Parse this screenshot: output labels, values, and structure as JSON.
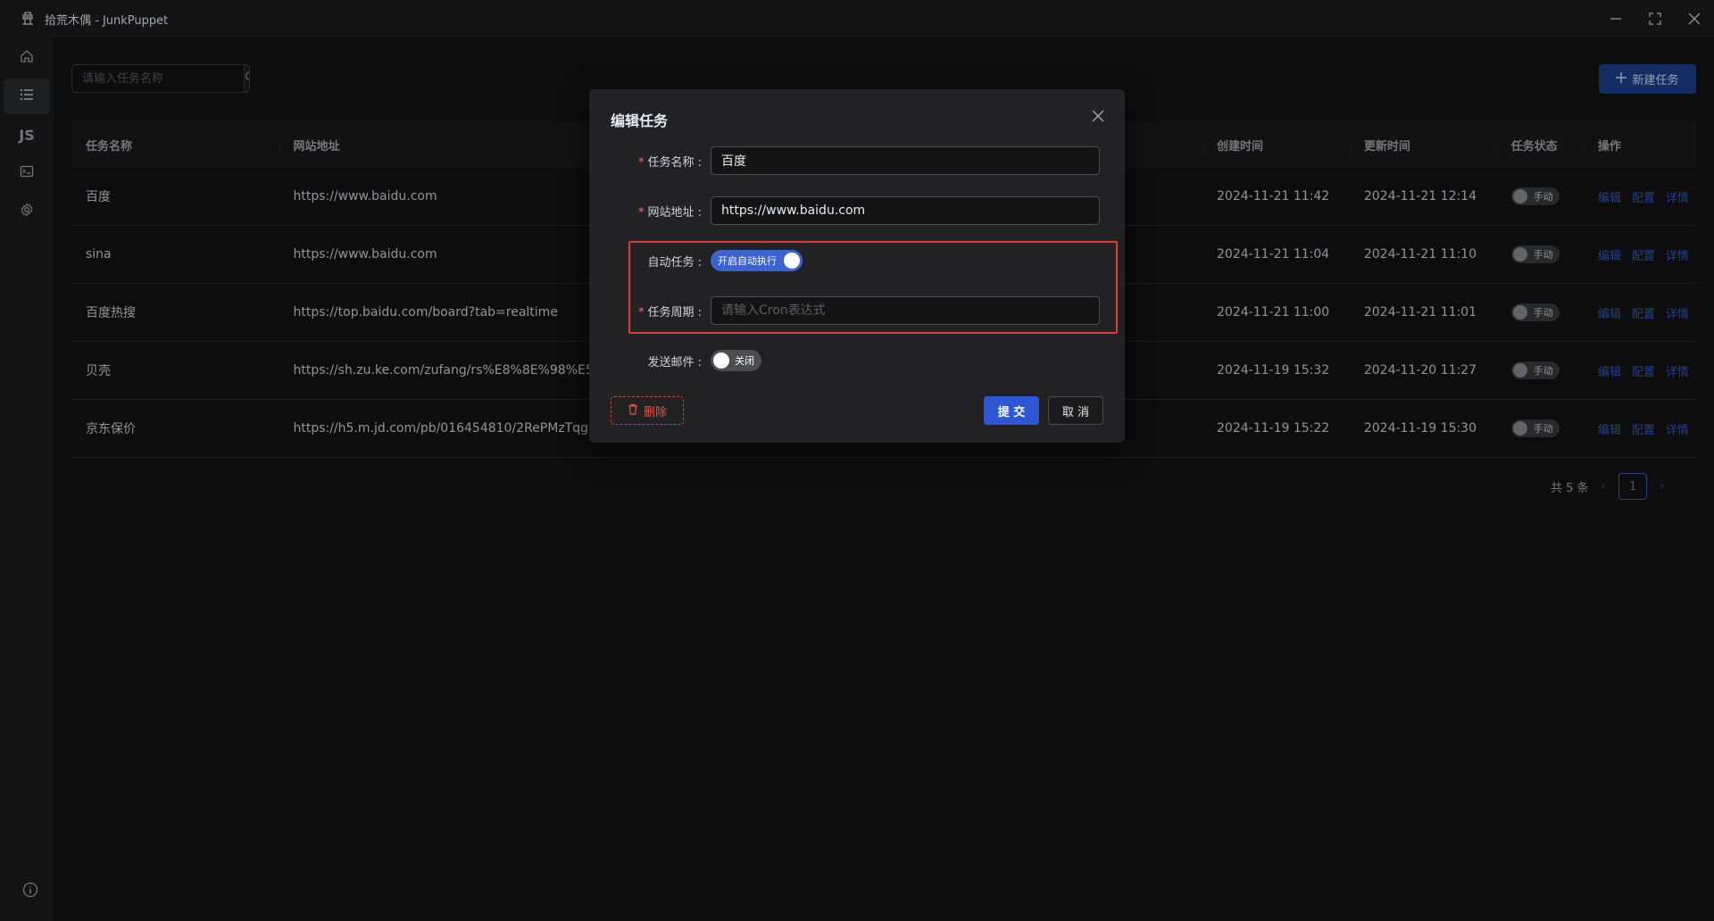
{
  "window": {
    "title": "拾荒木偶 - JunkPuppet",
    "logo_icon": "puppet-logo-icon",
    "controls": [
      "minimize-icon",
      "restore-icon",
      "close-icon"
    ]
  },
  "sidebar": {
    "items": [
      {
        "name": "home",
        "icon": "home-icon"
      },
      {
        "name": "tasks",
        "icon": "list-icon",
        "active": true
      },
      {
        "name": "scripts",
        "label": "JS"
      },
      {
        "name": "terminal",
        "icon": "terminal-icon"
      },
      {
        "name": "settings",
        "icon": "gear-icon"
      }
    ],
    "bottom_icon": "info-icon"
  },
  "toolbar": {
    "search_placeholder": "请输入任务名称",
    "new_task_label": "新建任务"
  },
  "table": {
    "columns": {
      "name": "任务名称",
      "url": "网站地址",
      "created": "创建时间",
      "updated": "更新时间",
      "status": "任务状态",
      "ops": "操作"
    },
    "rows": [
      {
        "name": "百度",
        "url": "https://www.baidu.com",
        "created": "2024-11-21 11:42",
        "updated": "2024-11-21 12:14",
        "status": "手动"
      },
      {
        "name": "sina",
        "url": "https://www.baidu.com",
        "created": "2024-11-21 11:04",
        "updated": "2024-11-21 11:10",
        "status": "手动"
      },
      {
        "name": "百度热搜",
        "url": "https://top.baidu.com/board?tab=realtime",
        "created": "2024-11-21 11:00",
        "updated": "2024-11-21 11:01",
        "status": "手动"
      },
      {
        "name": "贝壳",
        "url": "https://sh.zu.ke.com/zufang/rs%E8%8E%98%E5%",
        "created": "2024-11-19 15:32",
        "updated": "2024-11-20 11:27",
        "status": "手动"
      },
      {
        "name": "京东保价",
        "url": "https://h5.m.jd.com/pb/016454810/2RePMzTqg6",
        "created": "2024-11-19 15:22",
        "updated": "2024-11-19 15:30",
        "status": "手动"
      }
    ],
    "op_labels": {
      "edit": "编辑",
      "config": "配置",
      "detail": "详情"
    }
  },
  "pagination": {
    "total_text": "共 5 条",
    "current_page": "1"
  },
  "dialog": {
    "title": "编辑任务",
    "name_label": "任务名称 :",
    "name_value": "百度",
    "url_label": "网站地址 :",
    "url_value": "https://www.baidu.com",
    "auto_label": "自动任务 :",
    "auto_toggle_text": "开启自动执行",
    "cron_label": "任务周期 :",
    "cron_placeholder": "请输入Cron表达式",
    "email_label": "发送邮件 :",
    "email_toggle_text": "关闭",
    "delete_label": "删除",
    "submit_label": "提 交",
    "cancel_label": "取 消"
  },
  "colors": {
    "primary": "#2e58d3",
    "highlight_border": "#e03c31",
    "link": "#2f5fc7",
    "danger": "#e05a50"
  }
}
